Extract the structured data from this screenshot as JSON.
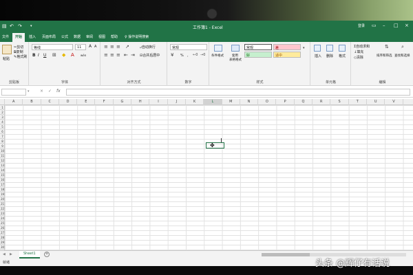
{
  "titlebar": {
    "title": "工作簿1 - Excel",
    "login": "登录",
    "save_icon": "save-icon",
    "undo_icon": "undo-icon",
    "redo_icon": "redo-icon"
  },
  "tabs": [
    "文件",
    "开始",
    "插入",
    "页面布局",
    "公式",
    "数据",
    "审阅",
    "视图",
    "帮助"
  ],
  "active_tab": "开始",
  "search": "操作说明搜索",
  "ribbon": {
    "clipboard": {
      "paste": "粘贴",
      "cut": "剪切",
      "copy": "复制",
      "format_painter": "格式刷",
      "label": "剪贴板"
    },
    "font": {
      "name": "等线",
      "size": "11",
      "bold": "B",
      "italic": "I",
      "underline": "U",
      "grow": "A",
      "shrink": "A",
      "label": "字体",
      "wen": "wén"
    },
    "alignment": {
      "wrap": "自动换行",
      "merge": "合并后居中",
      "label": "对齐方式"
    },
    "number": {
      "format": "常规",
      "label": "数字",
      "percent": "%",
      "comma": ","
    },
    "styles": {
      "cond": "条件格式",
      "table": "套用",
      "table2": "表格格式",
      "normal": "常规",
      "bad": "差",
      "good": "好",
      "neutral": "适中",
      "label": "样式"
    },
    "cells": {
      "insert": "插入",
      "delete": "删除",
      "format": "格式",
      "label": "单元格"
    },
    "editing": {
      "autosum": "自动求和",
      "fill": "填充",
      "clear": "清除",
      "sort": "排序和筛选",
      "find": "查找和选择",
      "label": "编辑"
    }
  },
  "formula_bar": {
    "fx": "fx",
    "cancel": "×",
    "enter": "✓"
  },
  "columns": [
    "A",
    "B",
    "C",
    "D",
    "E",
    "F",
    "G",
    "H",
    "I",
    "J",
    "K",
    "L",
    "M",
    "N",
    "O",
    "P",
    "Q",
    "R",
    "S",
    "T",
    "U",
    "V"
  ],
  "selected_column": "L",
  "rows": [
    "1",
    "2",
    "3",
    "4",
    "5",
    "6",
    "7",
    "8",
    "9",
    "10",
    "11",
    "12",
    "13",
    "14",
    "15",
    "16",
    "17",
    "18",
    "19",
    "20",
    "21",
    "22",
    "23",
    "24",
    "25",
    "26",
    "27",
    "28",
    "29",
    "30"
  ],
  "sheet": {
    "name": "Sheet1",
    "add": "+"
  },
  "status": {
    "ready": "就绪"
  },
  "watermark": "头条 @辉仔有话说",
  "colors": {
    "excel_green": "#217346"
  }
}
